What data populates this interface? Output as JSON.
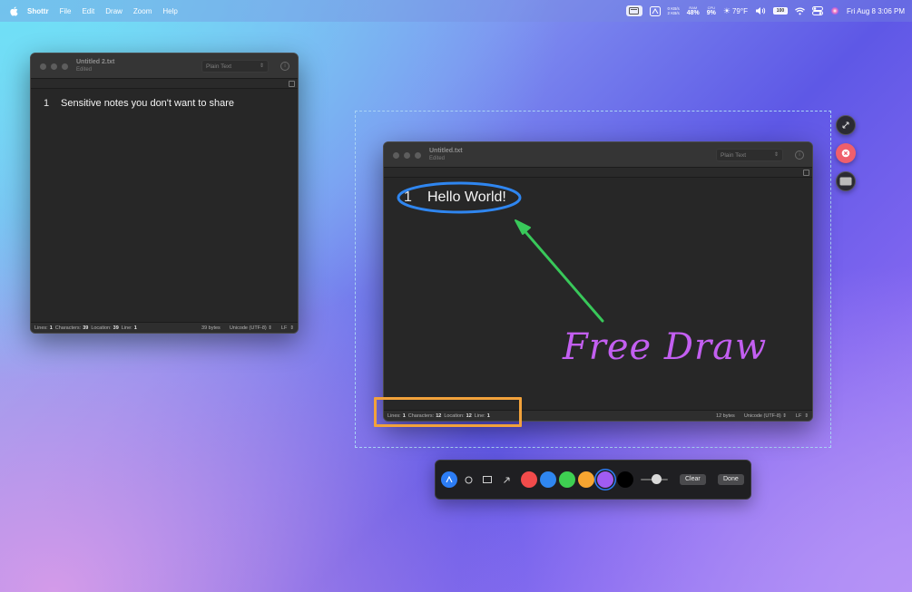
{
  "menubar": {
    "app_name": "Shottr",
    "items": [
      "File",
      "Edit",
      "Draw",
      "Zoom",
      "Help"
    ],
    "net_up": "0 KB/s",
    "net_down": "2 KB/s",
    "ram_label": "RAM",
    "ram_value": "48%",
    "cpu_label": "CPU",
    "cpu_value": "9%",
    "weather": "79°F",
    "battery_value": "100",
    "datetime": "Fri Aug 8  3:06 PM"
  },
  "window_back": {
    "title": "Untitled 2.txt",
    "subtitle": "Edited",
    "syntax": "Plain Text",
    "line_number": "1",
    "line_text": "Sensitive notes you don't want to share",
    "status": {
      "lines_label": "Lines:",
      "lines_value": "1",
      "chars_label": "Characters:",
      "chars_value": "39",
      "location_label": "Location:",
      "location_value": "39",
      "line_label": "Line:",
      "line_value": "1",
      "bytes": "39 bytes",
      "encoding": "Unicode (UTF-8)",
      "line_ending": "LF"
    }
  },
  "window_front": {
    "title": "Untitled.txt",
    "subtitle": "Edited",
    "syntax": "Plain Text",
    "line_number": "1",
    "line_text": "Hello World!",
    "status": {
      "lines_label": "Lines:",
      "lines_value": "1",
      "chars_label": "Characters:",
      "chars_value": "12",
      "location_label": "Location:",
      "location_value": "12",
      "line_label": "Line:",
      "line_value": "1",
      "bytes": "12 bytes",
      "encoding": "Unicode (UTF-8)",
      "line_ending": "LF"
    }
  },
  "annotations": {
    "free_draw_text": "Free Draw",
    "ellipse_color": "#2f86f0",
    "arrow_color": "#39c85a",
    "box_color": "#f2a23b",
    "text_color": "#c35ff1"
  },
  "side_controls": {
    "icons": [
      "expand-icon",
      "close-icon",
      "window-icon"
    ]
  },
  "toolbar": {
    "tools": [
      "pen-icon",
      "ellipse-tool-icon",
      "rectangle-tool-icon",
      "arrow-tool-icon"
    ],
    "colors": [
      "#f24b4b",
      "#2f86f0",
      "#3ecf52",
      "#f7a531",
      "#a05cf2",
      "#000000"
    ],
    "clear_label": "Clear",
    "done_label": "Done"
  }
}
